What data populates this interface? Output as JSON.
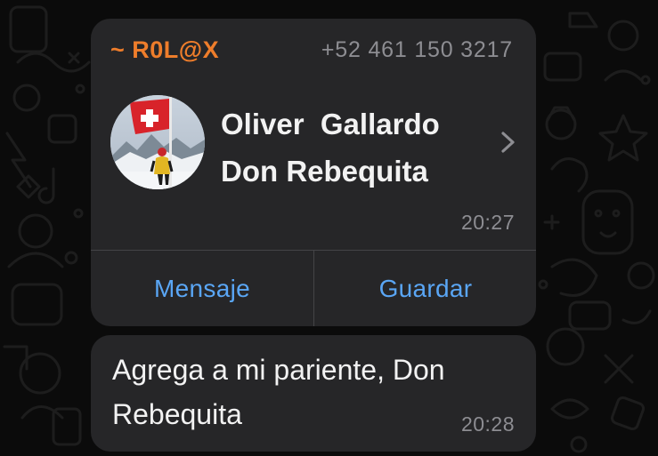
{
  "theme": {
    "bubble_bg": "#262628",
    "sender_color": "#ee7d2b",
    "action_color": "#5aa6f5",
    "meta_color": "#8d8d92"
  },
  "contact_card": {
    "sender_name": "~ R0L@X",
    "sender_phone": "+52 461 150 3217",
    "contact_name": "Oliver  Gallardo Don Rebequita",
    "avatar_icon": "profile-photo-with-swiss-flag",
    "chevron_icon": "chevron-right-icon",
    "time": "20:27",
    "actions": {
      "message_label": "Mensaje",
      "save_label": "Guardar"
    }
  },
  "text_message": {
    "text": "Agrega a mi pariente, Don Rebequita",
    "time": "20:28"
  }
}
